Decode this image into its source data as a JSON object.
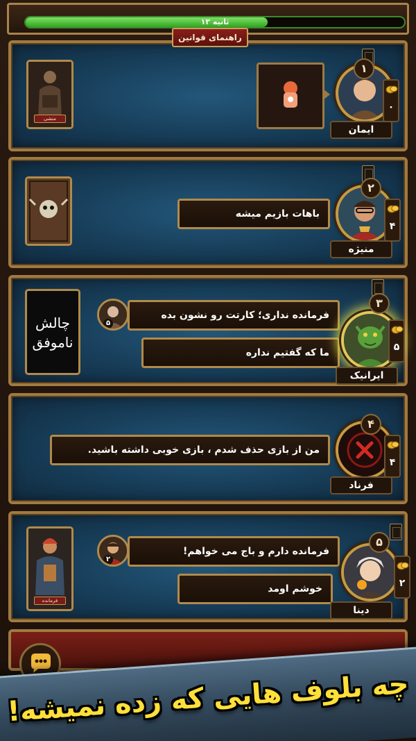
{
  "timer": {
    "text": "۱۳ ثانیه",
    "progress": 0.64
  },
  "rules_button": "راهنمای قوانین",
  "players": [
    {
      "rank": "۱",
      "name": "ایمان",
      "coins": "۰",
      "card_label": "منشی"
    },
    {
      "rank": "۲",
      "name": "منیژه",
      "coins": "۴",
      "message": "باهات بازیم میشه"
    },
    {
      "rank": "۳",
      "name": "ایرانیک",
      "coins": "۵",
      "challenge": [
        "چالش",
        "ناموفق"
      ],
      "action": "فرمانده نداری؛ کارتت رو نشون بده",
      "action_target_coins": "۵",
      "message": "ما که گفتیم نداره"
    },
    {
      "rank": "۴",
      "name": "فرناد",
      "coins": "۴",
      "message": "من از بازی حذف شدم ، بازی خوبی داشته باشید."
    },
    {
      "rank": "۵",
      "name": "دینا",
      "coins": "۲",
      "card_label": "فرمانده",
      "action": "فرمانده دارم و باج می خواهم!",
      "action_target_coins": "۲",
      "message": "خوشم اومد"
    }
  ],
  "banner": "چه بلوف هایی که زده نمیشه!",
  "colors": {
    "gold": "#c59a44",
    "panel": "#173d58",
    "banner_text": "#ffe03a",
    "timer_fill": "#4fc63a"
  }
}
